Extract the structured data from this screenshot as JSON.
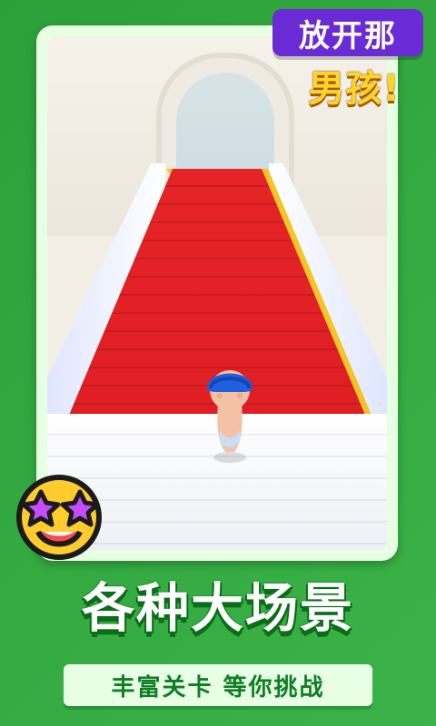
{
  "badge": {
    "line1": "放开那",
    "line2": "男孩!"
  },
  "headline": "各种大场景",
  "subtitle": "丰富关卡 等你挑战",
  "colors": {
    "background_green": "#2fae3d",
    "badge_purple": "#6a2bd6",
    "badge_yellow": "#ffd52a",
    "carpet_red": "#e52427",
    "carpet_border": "#f3c21a"
  },
  "icons": {
    "emoji": "star-struck-emoji",
    "character": "baby-character"
  }
}
